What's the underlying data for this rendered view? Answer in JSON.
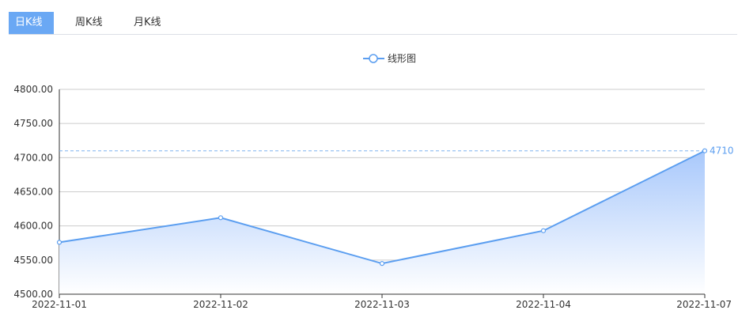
{
  "tabs": [
    {
      "label": "日K线",
      "active": true
    },
    {
      "label": "周K线",
      "active": false
    },
    {
      "label": "月K线",
      "active": false
    }
  ],
  "colors": {
    "accent": "#6aa8f4",
    "line": "#5b9ef0",
    "area_top": "#a8c8fb",
    "area_bottom": "#ffffff",
    "grid": "#cccccc",
    "markline": "#7fb3ef"
  },
  "chart_data": {
    "type": "area",
    "categories": [
      "2022-11-01",
      "2022-11-02",
      "2022-11-03",
      "2022-11-04",
      "2022-11-07"
    ],
    "series": [
      {
        "name": "线形图",
        "values": [
          4576,
          4612,
          4545,
          4593,
          4710
        ]
      }
    ],
    "ylim": [
      4500,
      4800
    ],
    "yticks": [
      "4500.00",
      "4550.00",
      "4600.00",
      "4650.00",
      "4700.00",
      "4750.00",
      "4800.00"
    ],
    "markline": {
      "value": 4710,
      "label": "4710"
    },
    "legend": {
      "position": "top-center",
      "label": "线形图"
    },
    "grid": true,
    "xlabel": "",
    "ylabel": ""
  }
}
